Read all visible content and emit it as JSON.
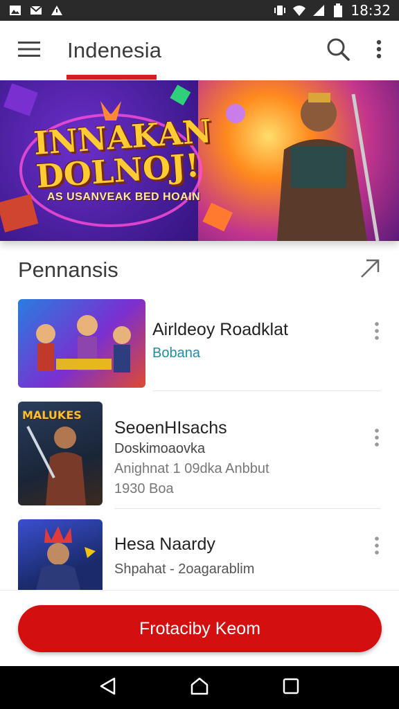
{
  "status_bar": {
    "time": "18:32",
    "left_icons": [
      "image-icon",
      "mail-icon",
      "download-icon"
    ],
    "right_icons": [
      "vibrate-icon",
      "wifi-icon",
      "signal-icon",
      "battery-icon"
    ]
  },
  "app_bar": {
    "title": "Indenesia"
  },
  "banner": {
    "title_line1": "INNAKAN",
    "title_line2": "DOLNOJ!",
    "tagline": "AS USANVEAK BED HOAIN"
  },
  "section": {
    "title": "Pennansis"
  },
  "items": [
    {
      "title": "Airldeoy Roadklat",
      "subtitle": "Bobana",
      "subtitle2": "",
      "subtitle3": ""
    },
    {
      "title": "SeoenHIsachs",
      "subtitle": "Doskimoaovka",
      "subtitle2": "Anighnat 1 09dka Anbbut",
      "subtitle3": "1930 Boa",
      "thumb_label": "MALUKES"
    },
    {
      "title": "Hesa Naardy",
      "subtitle": "Shpahat - 2oagarablim",
      "subtitle2": "",
      "subtitle3": ""
    }
  ],
  "cta": {
    "label": "Frotaciby Keom"
  },
  "colors": {
    "accent": "#d40f0f",
    "link": "#1a8fa6"
  }
}
